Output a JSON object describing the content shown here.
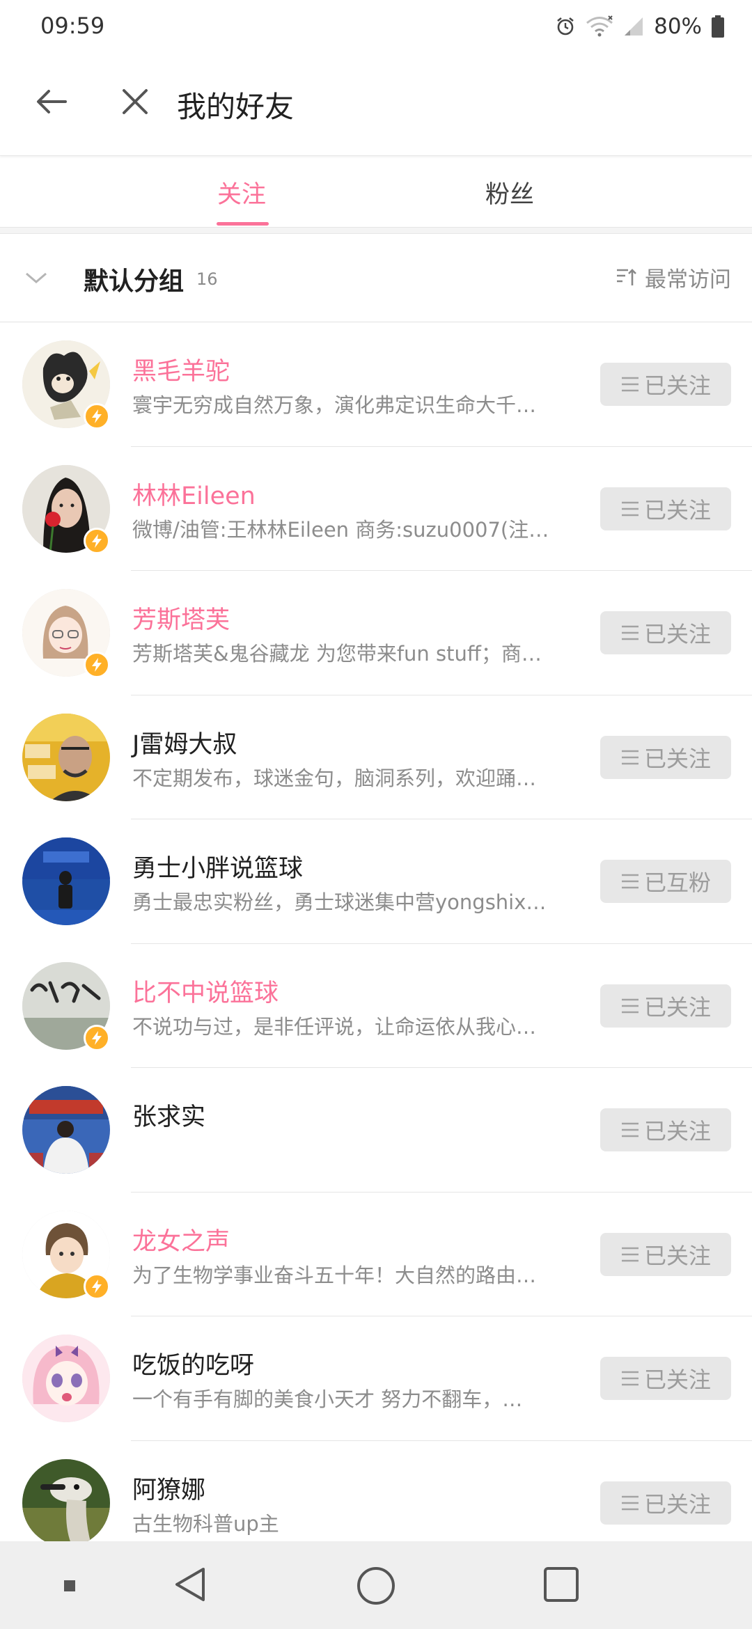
{
  "status_bar": {
    "time": "09:59",
    "battery": "80%",
    "icons": [
      "alarm-icon",
      "wifi-icon",
      "signal-icon",
      "battery-icon"
    ]
  },
  "header": {
    "title": "我的好友",
    "back_icon": "back-arrow-icon",
    "close_icon": "close-icon"
  },
  "tabs": [
    {
      "label": "关注",
      "active": true
    },
    {
      "label": "粉丝",
      "active": false
    }
  ],
  "group": {
    "name": "默认分组",
    "count": "16",
    "sort_label": "最常访问"
  },
  "colors": {
    "accent": "#fb7299",
    "badge": "#ffb027",
    "button_bg": "#e7e7e7",
    "button_text": "#9c9c9c"
  },
  "users": [
    {
      "name": "黑毛羊驼",
      "sign": "寰宇无穷成自然万象，演化弗定识生命大千…",
      "button": "已关注",
      "vip": true,
      "badge": true
    },
    {
      "name": "林林Eileen",
      "sign": "微博/油管:王林林Eileen 商务:suzu0007(注…",
      "button": "已关注",
      "vip": true,
      "badge": true
    },
    {
      "name": "芳斯塔芙",
      "sign": "芳斯塔芙&鬼谷藏龙 为您带来fun stuff；商…",
      "button": "已关注",
      "vip": true,
      "badge": true
    },
    {
      "name": "J雷姆大叔",
      "sign": "不定期发布，球迷金句，脑洞系列，欢迎踊…",
      "button": "已关注",
      "vip": false,
      "badge": false
    },
    {
      "name": "勇士小胖说篮球",
      "sign": "勇士最忠实粉丝，勇士球迷集中营yongshix…",
      "button": "已互粉",
      "vip": false,
      "badge": false
    },
    {
      "name": "比不中说篮球",
      "sign": "不说功与过，是非任评说，让命运依从我心…",
      "button": "已关注",
      "vip": true,
      "badge": true
    },
    {
      "name": "张求实",
      "sign": "",
      "button": "已关注",
      "vip": false,
      "badge": false
    },
    {
      "name": "龙女之声",
      "sign": "为了生物学事业奋斗五十年！大自然的路由…",
      "button": "已关注",
      "vip": true,
      "badge": true
    },
    {
      "name": "吃饭的吃呀",
      "sign": "一个有手有脚的美食小天才 努力不翻车，…",
      "button": "已关注",
      "vip": false,
      "badge": false
    },
    {
      "name": "阿獠娜",
      "sign": "古生物科普up主",
      "button": "已关注",
      "vip": false,
      "badge": false
    }
  ]
}
